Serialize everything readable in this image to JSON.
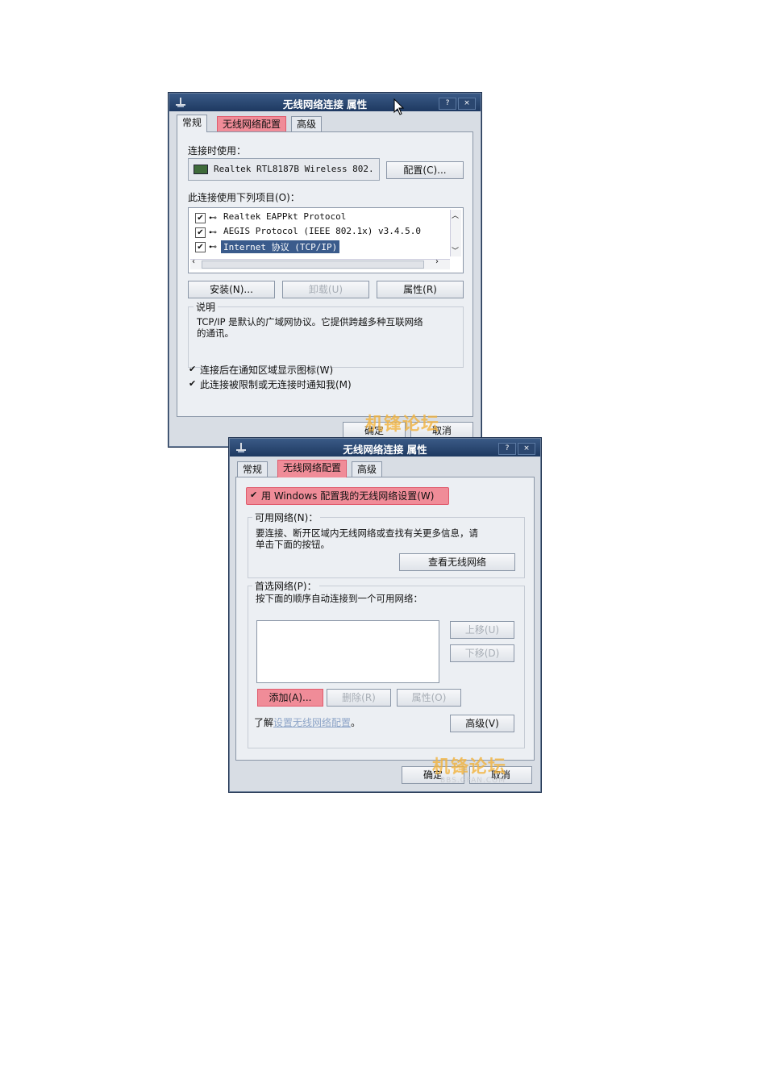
{
  "dialog1": {
    "title": "无线网络连接 属性",
    "help": "?",
    "close": "×",
    "tabs": [
      "常规",
      "无线网络配置",
      "高级"
    ],
    "connect_using_label": "连接时使用：",
    "adapter": "Realtek RTL8187B Wireless 802.",
    "configure_button": "配置(C)...",
    "items_label": "此连接使用下列项目(O)：",
    "items": [
      "Realtek EAPPkt Protocol",
      "AEGIS Protocol (IEEE 802.1x) v3.4.5.0",
      "Internet 协议 (TCP/IP)"
    ],
    "install_button": "安装(N)...",
    "uninstall_button": "卸载(U)",
    "properties_button": "属性(R)",
    "description_label": "说明",
    "description_text1": "TCP/IP 是默认的广域网协议。它提供跨越多种互联网络",
    "description_text2": "的通讯。",
    "show_icon_label": "连接后在通知区域显示图标(W)",
    "notify_label": "此连接被限制或无连接时通知我(M)",
    "ok_button": "确定",
    "cancel_button": "取消"
  },
  "dialog2": {
    "title": "无线网络连接 属性",
    "help": "?",
    "close": "×",
    "tabs": [
      "常规",
      "无线网络配置",
      "高级"
    ],
    "use_windows_label": "用 Windows 配置我的无线网络设置(W)",
    "available_label": "可用网络(N)：",
    "available_text1": "要连接、断开区域内无线网络或查找有关更多信息，请",
    "available_text2": "单击下面的按钮。",
    "view_networks_button": "查看无线网络",
    "preferred_label": "首选网络(P)：",
    "preferred_text": "按下面的顺序自动连接到一个可用网络：",
    "move_up_button": "上移(U)",
    "move_down_button": "下移(D)",
    "add_button": "添加(A)...",
    "remove_button": "删除(R)",
    "props_button": "属性(O)",
    "learn_prefix": "了解",
    "learn_link": "设置无线网络配置",
    "learn_suffix": "。",
    "advanced_button": "高级(V)",
    "ok_button": "确定",
    "cancel_button": "取消"
  },
  "watermark": {
    "text": "机锋论坛",
    "sub": "BBS.GFAN.COM"
  },
  "colors": {
    "titlebar": "#1e3961",
    "highlight": "#f08c98",
    "dialog_bg": "#d8dde4",
    "selection": "#3a5b8c"
  }
}
